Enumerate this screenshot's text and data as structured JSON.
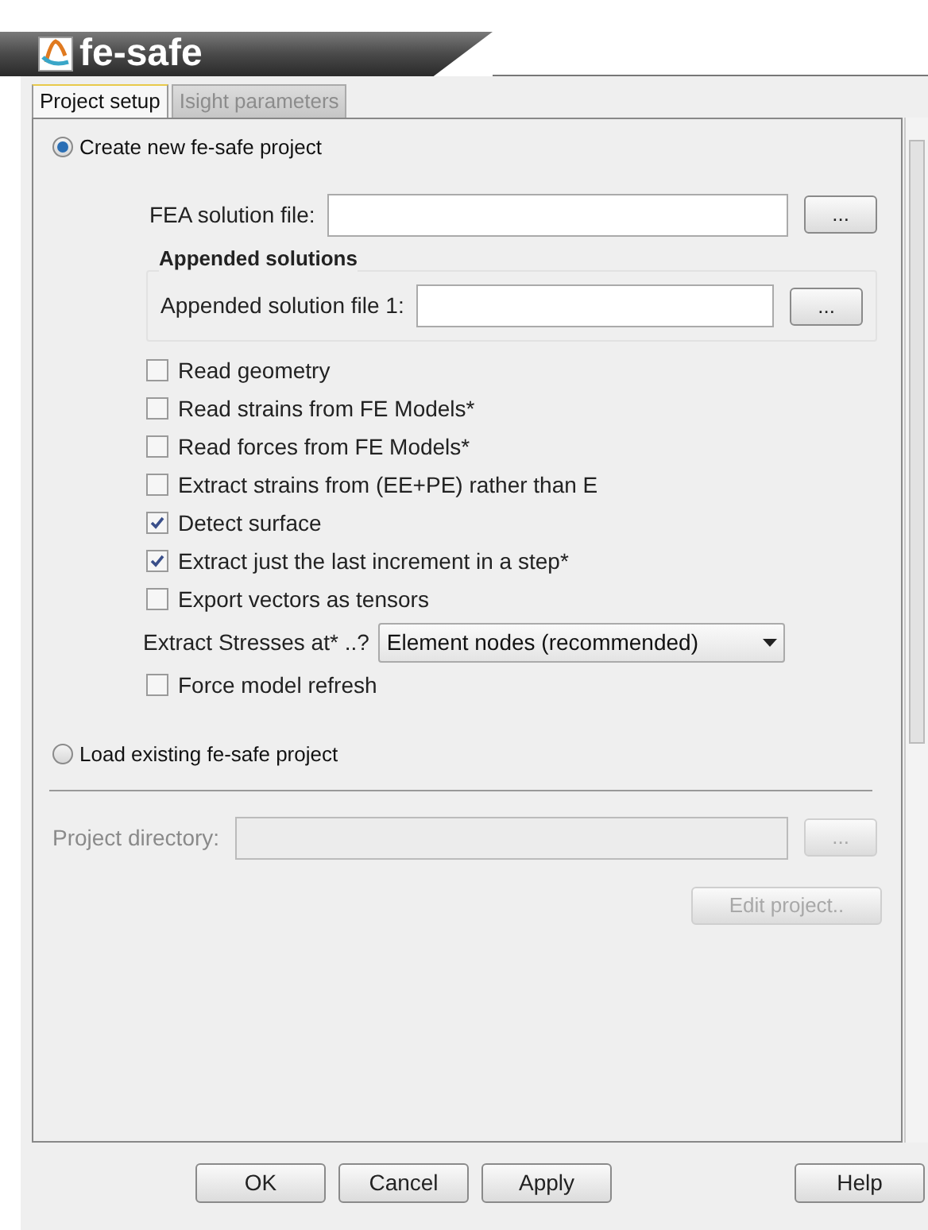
{
  "app": {
    "title": "fe-safe"
  },
  "tabs": [
    {
      "label": "Project setup",
      "selected": true,
      "disabled": false
    },
    {
      "label": "Isight parameters",
      "selected": false,
      "disabled": true
    }
  ],
  "create_option": {
    "label": "Create new fe-safe project",
    "selected": true
  },
  "fea_file": {
    "label": "FEA solution file:",
    "button": "..."
  },
  "appended": {
    "title": "Appended solutions",
    "label": "Appended solution file 1:",
    "button": "..."
  },
  "options": [
    {
      "kind": "checkbox",
      "label": "Read geometry",
      "checked": false
    },
    {
      "kind": "checkbox",
      "label": "Read strains from FE Models*",
      "checked": false
    },
    {
      "kind": "checkbox",
      "label": "Read forces from FE Models*",
      "checked": false
    },
    {
      "kind": "checkbox",
      "label": "Extract strains from (EE+PE) rather than E",
      "checked": false
    },
    {
      "kind": "checkbox",
      "label": "Detect surface",
      "checked": true
    },
    {
      "kind": "checkbox",
      "label": "Extract just the last increment in a step*",
      "checked": true
    },
    {
      "kind": "checkbox",
      "label": "Export vectors as tensors",
      "checked": false
    },
    {
      "kind": "select",
      "label": "Extract Stresses at* ..?",
      "value": "Element nodes (recommended)"
    },
    {
      "kind": "checkbox",
      "label": "Force model refresh",
      "checked": false
    }
  ],
  "load_option": {
    "label": "Load existing fe-safe project",
    "selected": false
  },
  "project_directory": {
    "label": "Project directory:",
    "button": "...",
    "disabled": true
  },
  "edit_project": {
    "label": "Edit project..",
    "disabled": true
  },
  "buttons": [
    {
      "label": "OK",
      "kind": "left"
    },
    {
      "label": "Cancel",
      "kind": "left"
    },
    {
      "label": "Apply",
      "kind": "left"
    },
    {
      "label": "Help",
      "kind": "right"
    }
  ]
}
